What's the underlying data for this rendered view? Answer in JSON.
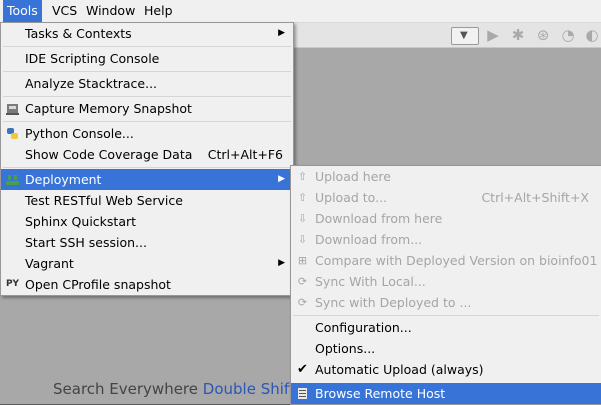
{
  "menubar": {
    "tools": "Tools",
    "vcs": "VCS",
    "window": "Window",
    "help": "Help"
  },
  "tools_menu": {
    "items": [
      {
        "label": "Tasks & Contexts"
      },
      {
        "label": "IDE Scripting Console"
      },
      {
        "label": "Analyze Stacktrace..."
      },
      {
        "label": "Capture Memory Snapshot"
      },
      {
        "label": "Python Console..."
      },
      {
        "label": "Show Code Coverage Data",
        "shortcut": "Ctrl+Alt+F6"
      },
      {
        "label": "Deployment"
      },
      {
        "label": "Test RESTful Web Service"
      },
      {
        "label": "Sphinx Quickstart"
      },
      {
        "label": "Start SSH session..."
      },
      {
        "label": "Vagrant"
      },
      {
        "label": "Open CProfile snapshot"
      }
    ]
  },
  "deployment_menu": {
    "items": [
      {
        "label": "Upload here"
      },
      {
        "label": "Upload to...",
        "shortcut": "Ctrl+Alt+Shift+X"
      },
      {
        "label": "Download from here"
      },
      {
        "label": "Download from..."
      },
      {
        "label": "Compare with Deployed Version on bioinfo01"
      },
      {
        "label": "Sync With Local..."
      },
      {
        "label": "Sync with Deployed to ..."
      },
      {
        "label": "Configuration..."
      },
      {
        "label": "Options..."
      },
      {
        "label": "Automatic Upload (always)"
      },
      {
        "label": "Browse Remote Host"
      }
    ]
  },
  "background": {
    "search_hint": "Search Everywhere",
    "search_shortcut": "Double Shift"
  },
  "icons": {
    "python_console": "PY",
    "cprofile": "PY"
  },
  "colors": {
    "highlight": "#3874d8",
    "menu_bg": "#f0f0f0",
    "disabled_text": "#a5a5a5"
  }
}
